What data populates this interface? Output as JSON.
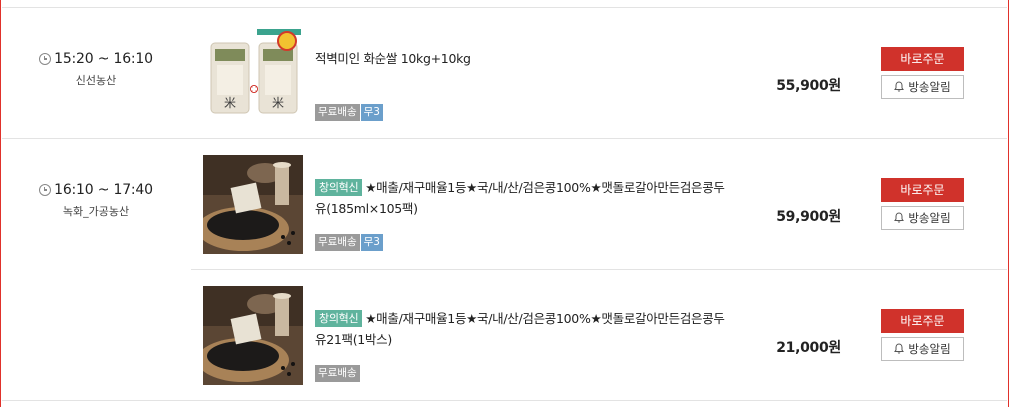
{
  "currency_suffix": "원",
  "slots": [
    {
      "time": "15:20 ~ 16:10",
      "category": "신선농산",
      "items": [
        {
          "promo": "",
          "title": "적벽미인 화순쌀 10kg+10kg",
          "tags": [
            "무료배송",
            "무3"
          ],
          "price": "55,900원",
          "order_label": "바로주문",
          "alarm_label": "방송알림",
          "image": "rice-bags"
        }
      ]
    },
    {
      "time": "16:10 ~ 17:40",
      "category": "녹화_가공농산",
      "items": [
        {
          "promo": "창의혁신",
          "title": "★매출/재구매율1등★국/내/산/검은콩100%★맷돌로갈아만든검은콩두유(185ml×105팩)",
          "tags": [
            "무료배송",
            "무3"
          ],
          "price": "59,900원",
          "order_label": "바로주문",
          "alarm_label": "방송알림",
          "image": "black-beans"
        },
        {
          "promo": "창의혁신",
          "title": "★매출/재구매율1등★국/내/산/검은콩100%★맷돌로갈아만든검은콩두유21팩(1박스)",
          "tags": [
            "무료배송"
          ],
          "price": "21,000원",
          "order_label": "바로주문",
          "alarm_label": "방송알림",
          "image": "black-beans"
        }
      ]
    }
  ]
}
